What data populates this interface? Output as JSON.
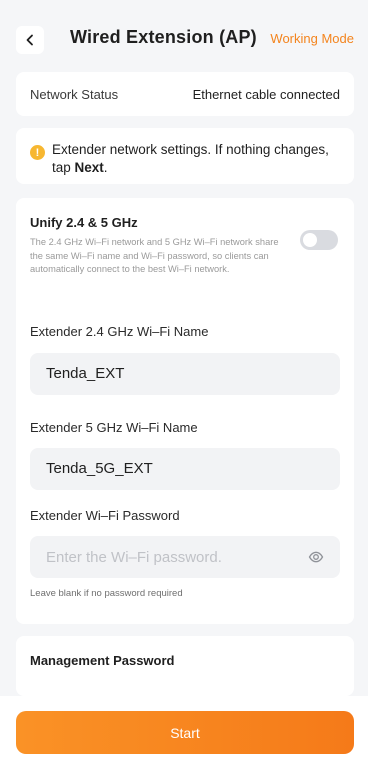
{
  "header": {
    "title": "Wired Extension (AP)",
    "mode_link": "Working Mode",
    "back_icon": "chevron-left-icon"
  },
  "status": {
    "label": "Network Status",
    "value": "Ethernet cable connected"
  },
  "notice": {
    "icon": "warning-icon",
    "text_before": "Extender network settings. If nothing changes, tap ",
    "text_bold": "Next",
    "text_after": "."
  },
  "unify": {
    "title": "Unify 2.4 & 5 GHz",
    "description": "The 2.4 GHz Wi–Fi network and 5 GHz Wi–Fi network share the same Wi–Fi name and Wi–Fi password, so clients can automatically connect to the best Wi–Fi network.",
    "enabled": false
  },
  "fields": {
    "ssid_24_label": "Extender 2.4 GHz Wi–Fi Name",
    "ssid_24_value": "Tenda_EXT",
    "ssid_5_label": "Extender 5 GHz Wi–Fi Name",
    "ssid_5_value": "Tenda_5G_EXT",
    "password_label": "Extender Wi–Fi Password",
    "password_placeholder": "Enter the Wi–Fi password.",
    "password_hint": "Leave blank if no password required",
    "eye_icon": "eye-icon"
  },
  "management": {
    "title": "Management Password"
  },
  "footer": {
    "start_label": "Start"
  },
  "colors": {
    "accent": "#f4841d",
    "background": "#f5f6f8",
    "warning": "#f7b731"
  }
}
